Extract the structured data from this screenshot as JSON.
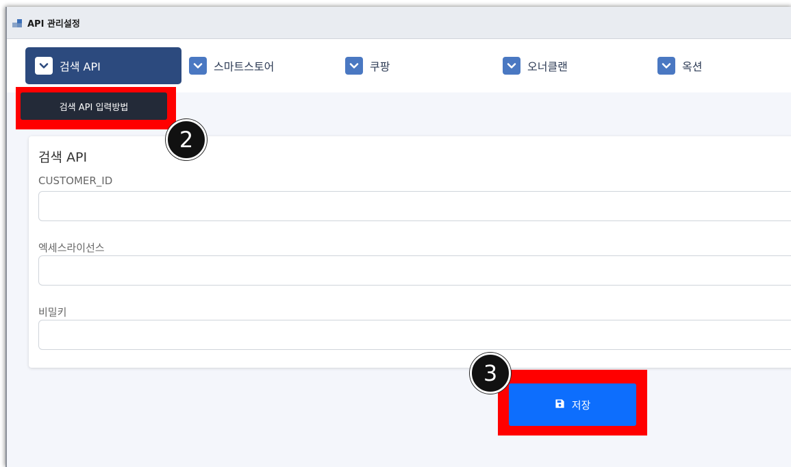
{
  "window": {
    "title": "API 관리설정"
  },
  "tabs": [
    {
      "label": "검색 API",
      "active": true
    },
    {
      "label": "스마트스토어",
      "active": false
    },
    {
      "label": "쿠팡",
      "active": false
    },
    {
      "label": "오너클랜",
      "active": false
    },
    {
      "label": "옥션",
      "active": false
    }
  ],
  "help_button": {
    "label": "검색 API 입력방법"
  },
  "annotations": {
    "step2": "2",
    "step3": "3"
  },
  "form": {
    "title": "검색 API",
    "fields": [
      {
        "label": "CUSTOMER_ID",
        "value": ""
      },
      {
        "label": "엑세스라이선스",
        "value": ""
      },
      {
        "label": "비밀키",
        "value": ""
      }
    ]
  },
  "save_button": {
    "label": "저장",
    "icon": "save-icon"
  },
  "colors": {
    "active_tab": "#2c4a7e",
    "tab_chevron": "#4a78c2",
    "primary": "#0d6efd",
    "highlight": "#ff0000",
    "dark_button": "#232a38"
  }
}
